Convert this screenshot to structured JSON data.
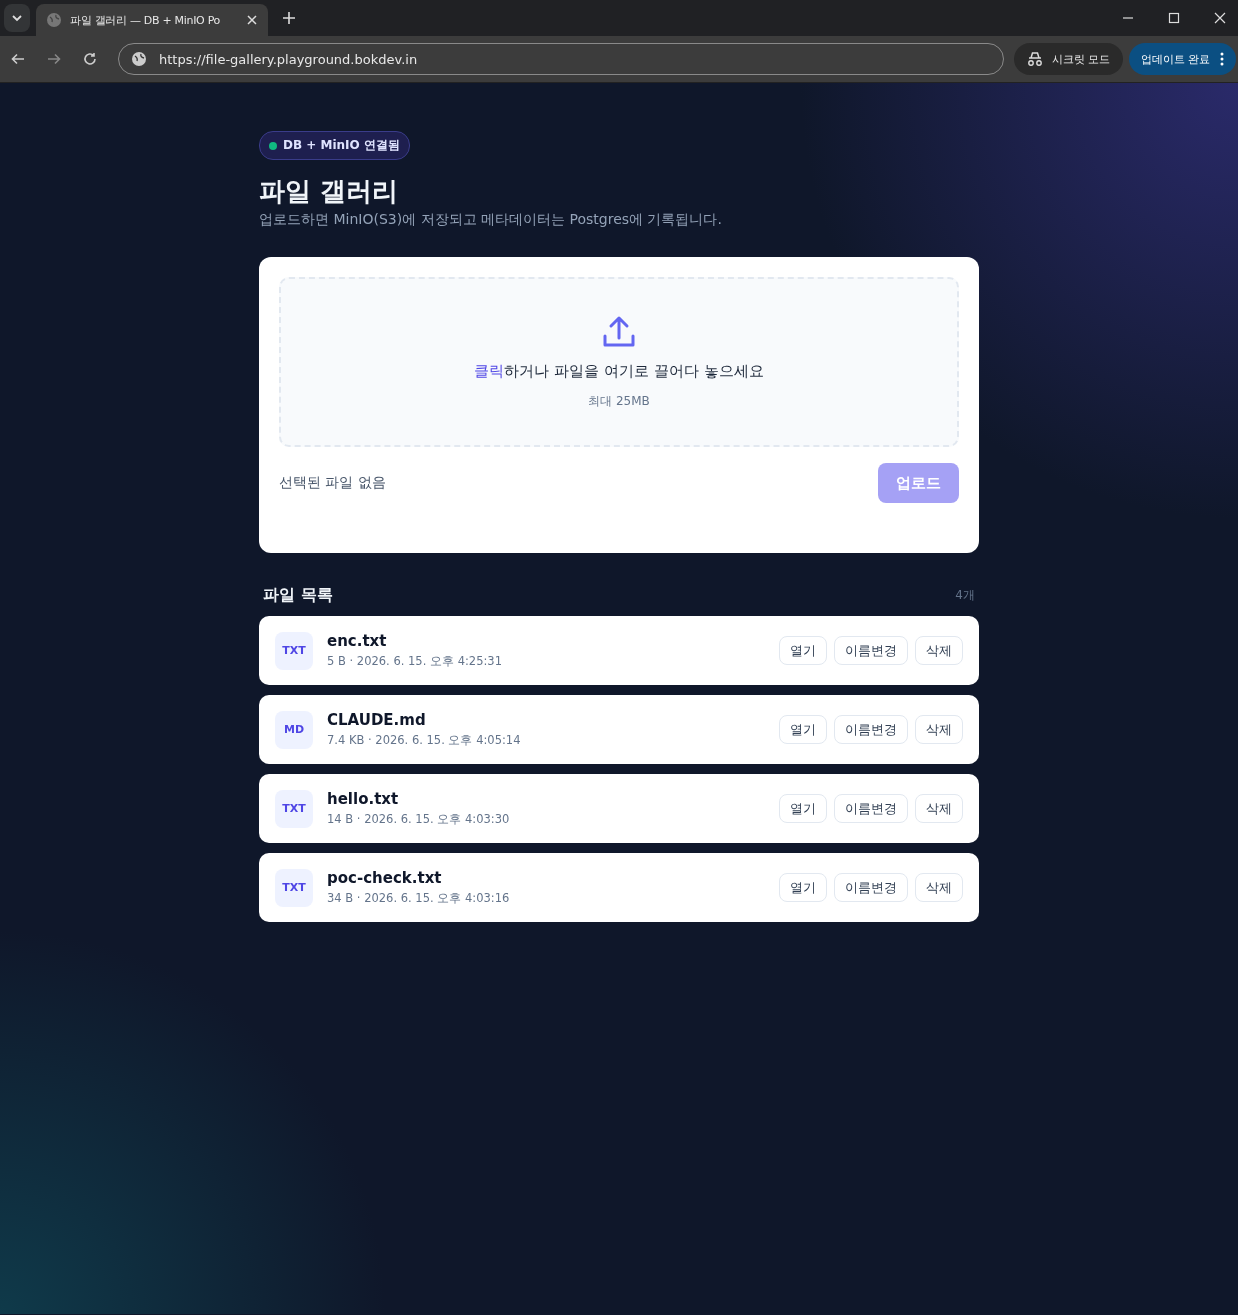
{
  "browser": {
    "tab_title": "파일 갤러리 — DB + MinIO Po",
    "url": "https://file-gallery.playground.bokdev.in",
    "incognito_label": "시크릿 모드",
    "update_label": "업데이트 완료"
  },
  "status_badge": {
    "label": "DB + MinIO 연결됨",
    "connected": true
  },
  "title": "파일 갤러리",
  "subtitle": "업로드하면 MinIO(S3)에 저장되고 메타데이터는 Postgres에 기록됩니다.",
  "dropzone": {
    "link": "클릭",
    "prompt": "하거나 파일을 여기로 끌어다 놓으세요",
    "limit": "최대 25MB"
  },
  "selected_file": "선택된 파일 없음",
  "upload_button": {
    "label": "업로드",
    "disabled": true
  },
  "list": {
    "title": "파일 목록",
    "count": "4개"
  },
  "files": [
    {
      "type": "TXT",
      "name": "enc.txt",
      "meta": "5 B · 2026. 6. 15. 오후 4:25:31",
      "actions": [
        "열기",
        "이름변경",
        "삭제"
      ]
    },
    {
      "type": "MD",
      "name": "CLAUDE.md",
      "meta": "7.4 KB · 2026. 6. 15. 오후 4:05:14",
      "actions": [
        "열기",
        "이름변경",
        "삭제"
      ]
    },
    {
      "type": "TXT",
      "name": "hello.txt",
      "meta": "14 B · 2026. 6. 15. 오후 4:03:30",
      "actions": [
        "열기",
        "이름변경",
        "삭제"
      ]
    },
    {
      "type": "TXT",
      "name": "poc-check.txt",
      "meta": "34 B · 2026. 6. 15. 오후 4:03:16",
      "actions": [
        "열기",
        "이름변경",
        "삭제"
      ]
    }
  ]
}
